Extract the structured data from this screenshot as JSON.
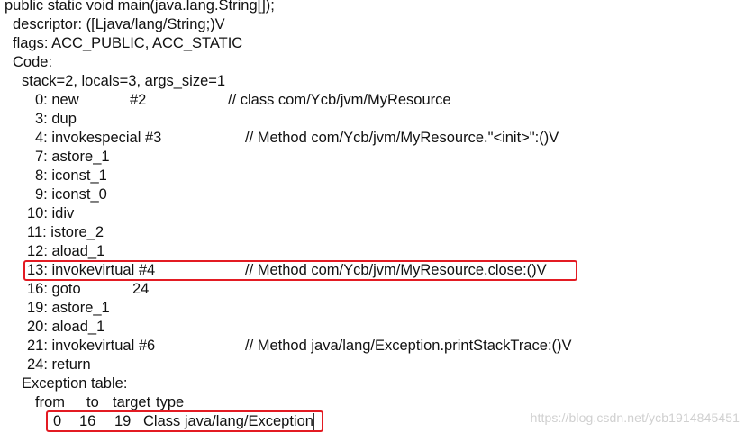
{
  "header": {
    "method_signature": "public static void main(java.lang.String[]);",
    "descriptor": "descriptor: ([Ljava/lang/String;)V",
    "flags": "flags: ACC_PUBLIC, ACC_STATIC",
    "code_label": "Code:",
    "stack_info": "stack=2, locals=3, args_size=1"
  },
  "instructions": [
    {
      "op": "0: new",
      "arg": "#2",
      "comment": "// class com/Ycb/jvm/MyResource"
    },
    {
      "op": "3: dup",
      "arg": "",
      "comment": ""
    },
    {
      "op": "4: invokespecial #3",
      "arg": "",
      "comment": "// Method com/Ycb/jvm/MyResource.\"<init>\":()V"
    },
    {
      "op": "7: astore_1",
      "arg": "",
      "comment": ""
    },
    {
      "op": "8: iconst_1",
      "arg": "",
      "comment": ""
    },
    {
      "op": "9: iconst_0",
      "arg": "",
      "comment": ""
    },
    {
      "op": "10: idiv",
      "arg": "",
      "comment": ""
    },
    {
      "op": "11: istore_2",
      "arg": "",
      "comment": ""
    },
    {
      "op": "12: aload_1",
      "arg": "",
      "comment": ""
    },
    {
      "op": "13: invokevirtual #4",
      "arg": "",
      "comment": "// Method com/Ycb/jvm/MyResource.close:()V"
    },
    {
      "op": "16: goto",
      "arg": "24",
      "comment": ""
    },
    {
      "op": "19: astore_1",
      "arg": "",
      "comment": ""
    },
    {
      "op": "20: aload_1",
      "arg": "",
      "comment": ""
    },
    {
      "op": "21: invokevirtual #6",
      "arg": "",
      "comment": "// Method java/lang/Exception.printStackTrace:()V"
    },
    {
      "op": "24: return",
      "arg": "",
      "comment": ""
    }
  ],
  "exception_table": {
    "label": "Exception table:",
    "headers": {
      "from": "from",
      "to": "to",
      "target": "target",
      "type": "type"
    },
    "rows": [
      {
        "from": "0",
        "to": "16",
        "target": "19",
        "type": "Class java/lang/Exception"
      }
    ]
  },
  "highlight_color": "#e31b23",
  "watermark": "https://blog.csdn.net/ycb1914845451"
}
